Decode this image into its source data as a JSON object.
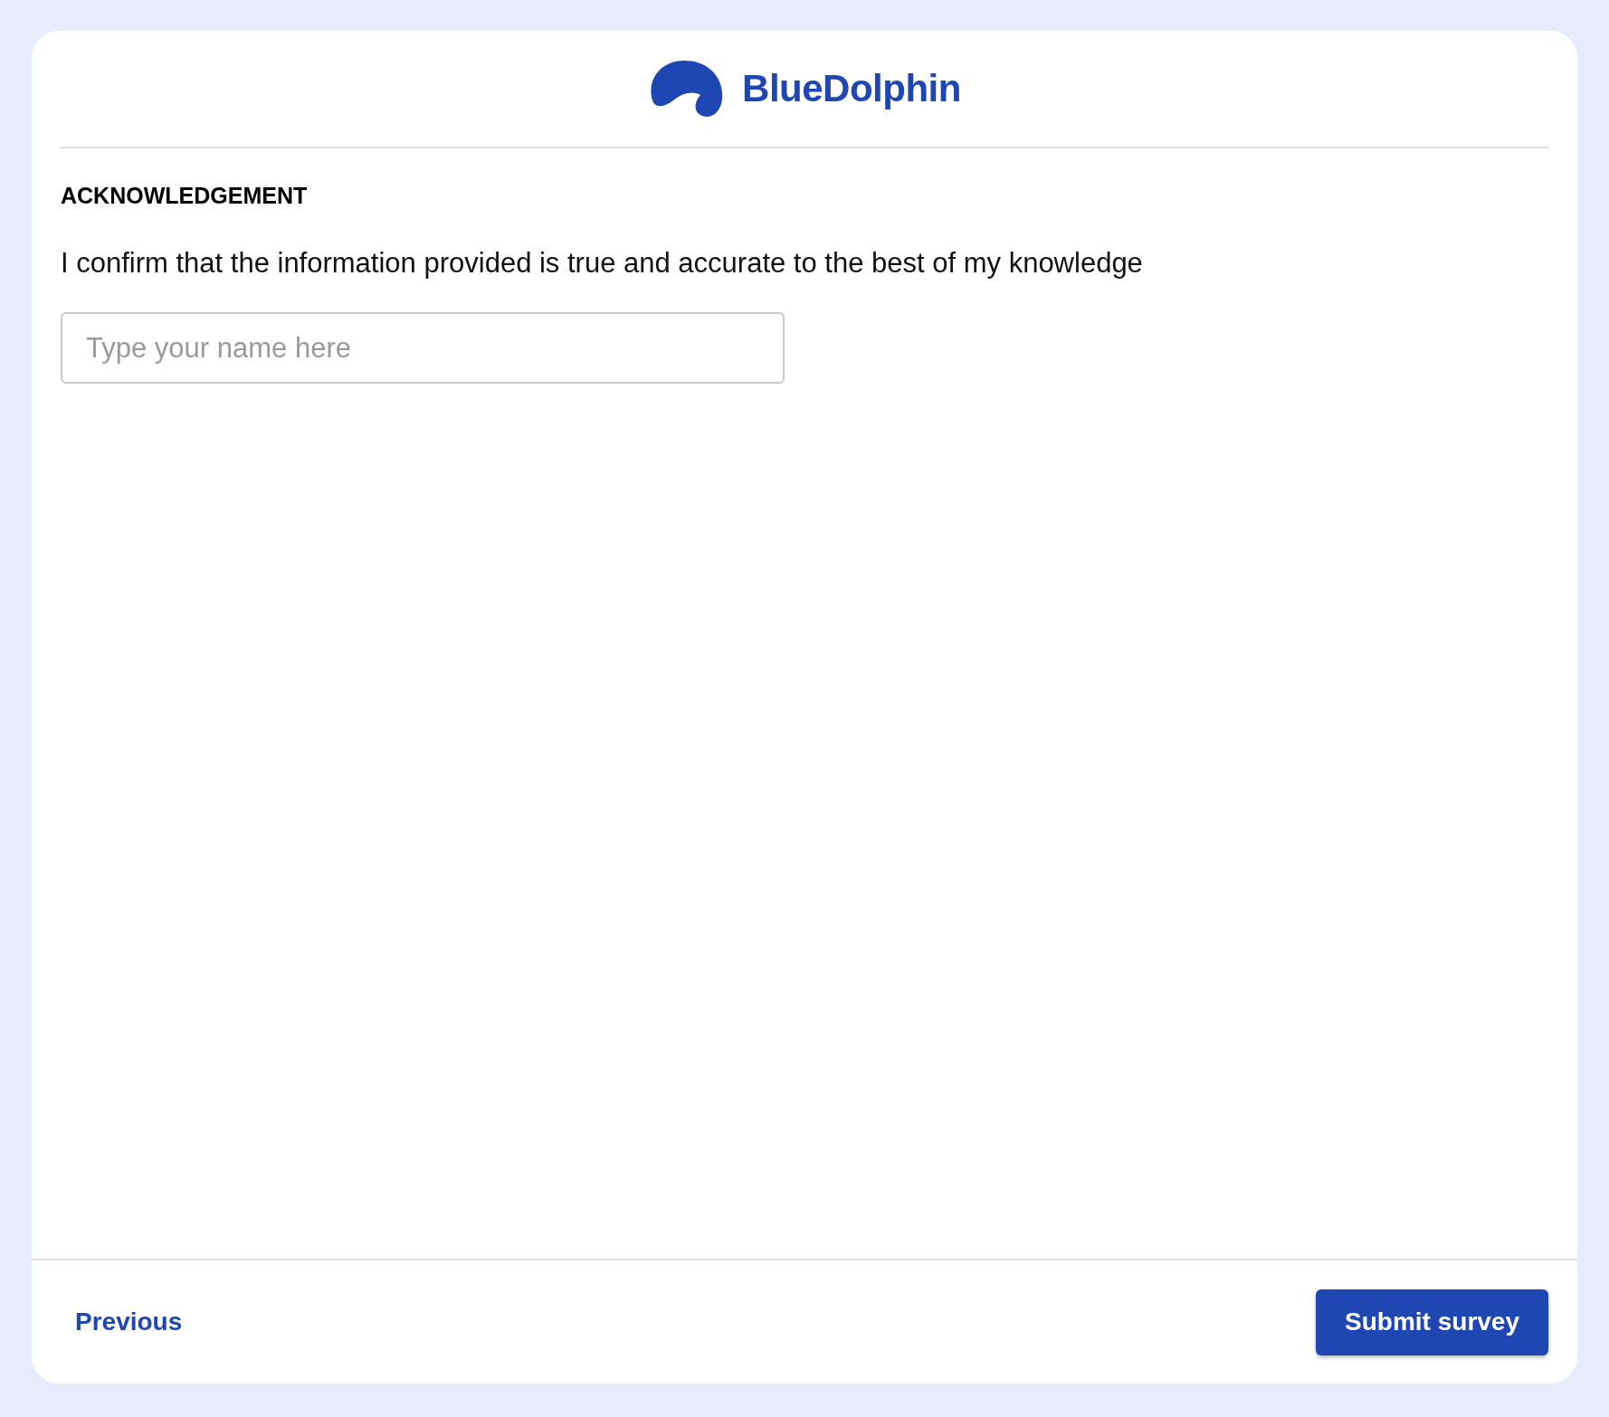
{
  "brand": {
    "name": "BlueDolphin"
  },
  "section": {
    "heading": "ACKNOWLEDGEMENT",
    "statement": "I confirm that the information provided is true and accurate to the best of my knowledge"
  },
  "name_field": {
    "placeholder": "Type your name here"
  },
  "footer": {
    "previous": "Previous",
    "submit": "Submit survey"
  }
}
